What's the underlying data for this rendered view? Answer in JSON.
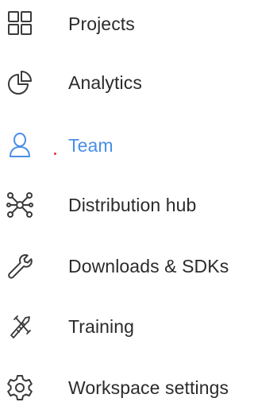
{
  "colors": {
    "text": "#2b2b2b",
    "icon": "#3a3a3a",
    "accent": "#4a8fe7",
    "marker": "#e0332e"
  },
  "nav": {
    "items": [
      {
        "label": "Projects",
        "icon": "grid-icon",
        "active": false
      },
      {
        "label": "Analytics",
        "icon": "pie-chart-icon",
        "active": false
      },
      {
        "label": "Team",
        "icon": "user-icon",
        "active": true
      },
      {
        "label": "Distribution hub",
        "icon": "network-hub-icon",
        "active": false
      },
      {
        "label": "Downloads & SDKs",
        "icon": "wrench-icon",
        "active": false
      },
      {
        "label": "Training",
        "icon": "tools-icon",
        "active": false
      },
      {
        "label": "Workspace settings",
        "icon": "gear-icon",
        "active": false
      }
    ]
  }
}
